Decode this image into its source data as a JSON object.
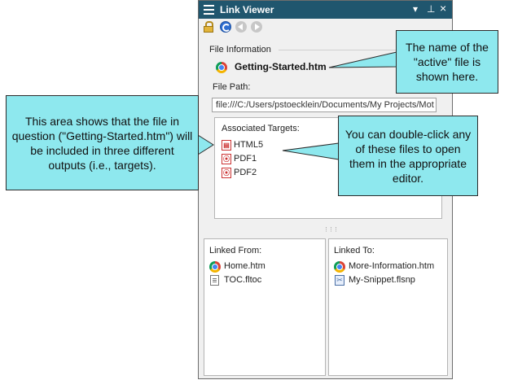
{
  "window": {
    "title": "Link Viewer",
    "controls": {
      "menu": "▾",
      "pin": "⊥",
      "close": "×"
    }
  },
  "toolbar": {
    "icons": [
      "lock-icon",
      "refresh-icon",
      "back-icon",
      "forward-icon"
    ]
  },
  "file_information": {
    "label": "File Information",
    "active_file": "Getting-Started.htm",
    "path_label": "File Path:",
    "path_value": "file:///C:/Users/pstoecklein/Documents/My Projects/Mot"
  },
  "associated_targets": {
    "label": "Associated Targets:",
    "items": [
      "HTML5",
      "PDF1",
      "PDF2"
    ]
  },
  "linked_from": {
    "label": "Linked From:",
    "items": [
      "Home.htm",
      "TOC.fltoc"
    ]
  },
  "linked_to": {
    "label": "Linked To:",
    "items": [
      "More-Information.htm",
      "My-Snippet.flsnp"
    ]
  },
  "callouts": {
    "active_file": "The name of the \"active\" file is shown here.",
    "targets": "This area shows that the file in question (\"Getting-Started.htm\") will be included in three different outputs (i.e., targets).",
    "double_click": "You can double-click any of these files to open them in the appropriate editor."
  },
  "colors": {
    "title_bar": "#20566e",
    "callout_fill": "#8ee8ee",
    "panel_bg": "#f0f0f0"
  }
}
